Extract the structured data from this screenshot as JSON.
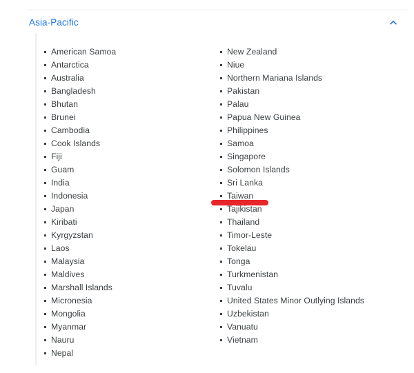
{
  "section": {
    "title": "Asia-Pacific",
    "expanded": true,
    "toggle_icon": "chevron-up-icon",
    "title_color": "#1a73e8"
  },
  "columns": {
    "left": [
      "American Samoa",
      "Antarctica",
      "Australia",
      "Bangladesh",
      "Bhutan",
      "Brunei",
      "Cambodia",
      "Cook Islands",
      "Fiji",
      "Guam",
      "India",
      "Indonesia",
      "Japan",
      "Kiribati",
      "Kyrgyzstan",
      "Laos",
      "Malaysia",
      "Maldives",
      "Marshall Islands",
      "Micronesia",
      "Mongolia",
      "Myanmar",
      "Nauru",
      "Nepal"
    ],
    "right": [
      "New Zealand",
      "Niue",
      "Northern Mariana Islands",
      "Pakistan",
      "Palau",
      "Papua New Guinea",
      "Philippines",
      "Samoa",
      "Singapore",
      "Solomon Islands",
      "Sri Lanka",
      "Taiwan",
      "Tajikistan",
      "Thailand",
      "Timor-Leste",
      "Tokelau",
      "Tonga",
      "Turkmenistan",
      "Tuvalu",
      "United States Minor Outlying Islands",
      "Uzbekistan",
      "Vanuatu",
      "Vietnam"
    ]
  },
  "annotation": {
    "name": "red-underline-stroke",
    "color": "#e8262a",
    "targets": "Taiwan"
  }
}
